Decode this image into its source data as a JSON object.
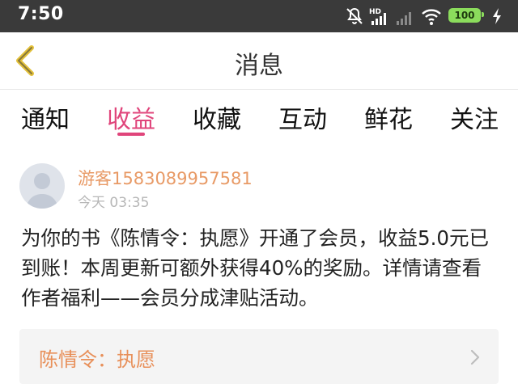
{
  "status_bar": {
    "time": "7:50",
    "network_label": "HD",
    "battery_level": "100",
    "icons": [
      "mute-icon",
      "hd-signal-icon",
      "signal-icon",
      "wifi-icon",
      "battery-icon",
      "charging-icon"
    ]
  },
  "header": {
    "title": "消息",
    "back_icon": "chevron-left-icon"
  },
  "tabs": [
    {
      "label": "通知",
      "active": false
    },
    {
      "label": "收益",
      "active": true
    },
    {
      "label": "收藏",
      "active": false
    },
    {
      "label": "互动",
      "active": false
    },
    {
      "label": "鲜花",
      "active": false
    },
    {
      "label": "关注",
      "active": false
    }
  ],
  "message": {
    "username": "游客1583089957581",
    "time": "今天 03:35",
    "body": "为你的书《陈情令：执愿》开通了会员，收益5.0元已到账！本周更新可额外获得40%的奖励。详情请查看作者福利——会员分成津贴活动。",
    "book_title": "陈情令：执愿"
  },
  "colors": {
    "accent": "#e0457b",
    "username": "#e89a66",
    "book_title": "#e8905a",
    "back_arrow": "#e3c03a",
    "status_bar": "#3a3a3a",
    "battery": "#8bdc5c"
  }
}
